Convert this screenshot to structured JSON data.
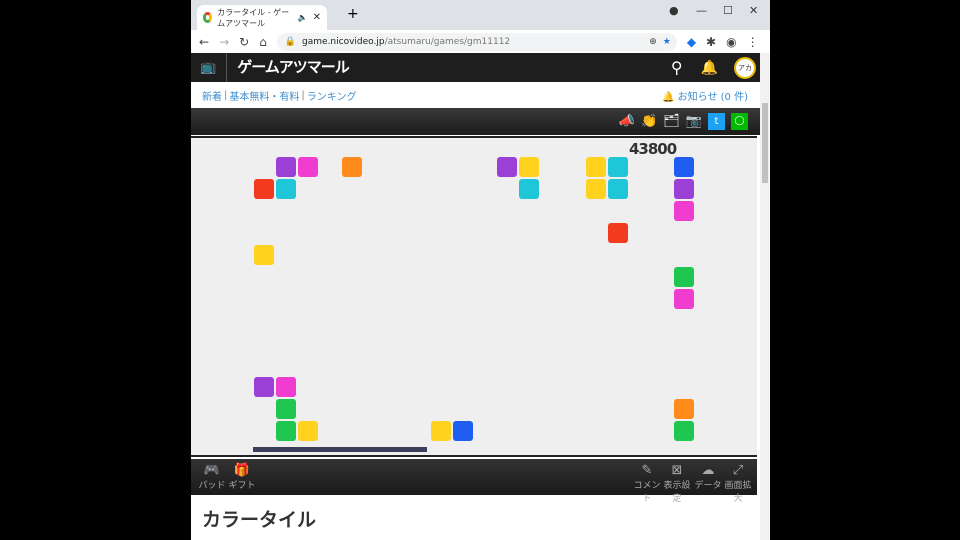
{
  "browser": {
    "tab_title": "カラータイル - ゲームアツマール",
    "url_domain": "game.nicovideo.jp",
    "url_path": "/atsumaru/games/gm11112"
  },
  "site": {
    "logo": "ゲームアツマール",
    "avatar": "アカ",
    "nav": [
      "新着",
      "基本無料・有料",
      "ランキング"
    ],
    "notice": "お知らせ (0 件)"
  },
  "game": {
    "score": "43800",
    "time_remaining_fraction": 0.31,
    "colors": {
      "purple": "#9b3fd6",
      "magenta": "#f03ccf",
      "orange": "#ff8c1a",
      "yellow": "#ffd21f",
      "cyan": "#1fc6d8",
      "blue": "#1f5ef0",
      "red": "#f23a1f",
      "green": "#1fc650"
    },
    "tiles": [
      [
        0,
        1,
        "purple"
      ],
      [
        0,
        2,
        "magenta"
      ],
      [
        0,
        4,
        "orange"
      ],
      [
        0,
        11,
        "purple"
      ],
      [
        0,
        12,
        "yellow"
      ],
      [
        0,
        15,
        "yellow"
      ],
      [
        0,
        16,
        "cyan"
      ],
      [
        0,
        19,
        "blue"
      ],
      [
        1,
        0,
        "red"
      ],
      [
        1,
        1,
        "cyan"
      ],
      [
        1,
        12,
        "cyan"
      ],
      [
        1,
        15,
        "yellow"
      ],
      [
        1,
        16,
        "cyan"
      ],
      [
        1,
        19,
        "purple"
      ],
      [
        2,
        19,
        "magenta"
      ],
      [
        3,
        16,
        "red"
      ],
      [
        4,
        0,
        "yellow"
      ],
      [
        5,
        19,
        "green"
      ],
      [
        6,
        19,
        "magenta"
      ],
      [
        10,
        0,
        "purple"
      ],
      [
        10,
        1,
        "magenta"
      ],
      [
        11,
        1,
        "green"
      ],
      [
        11,
        19,
        "orange"
      ],
      [
        12,
        1,
        "green"
      ],
      [
        12,
        2,
        "yellow"
      ],
      [
        12,
        8,
        "yellow"
      ],
      [
        12,
        9,
        "blue"
      ],
      [
        12,
        19,
        "green"
      ]
    ]
  },
  "bottom": {
    "pad": "パッド",
    "gift": "ギフト",
    "comment": "コメント",
    "display": "表示設定",
    "data": "データ",
    "fullscreen": "画面拡大"
  },
  "page_title": "カラータイル"
}
